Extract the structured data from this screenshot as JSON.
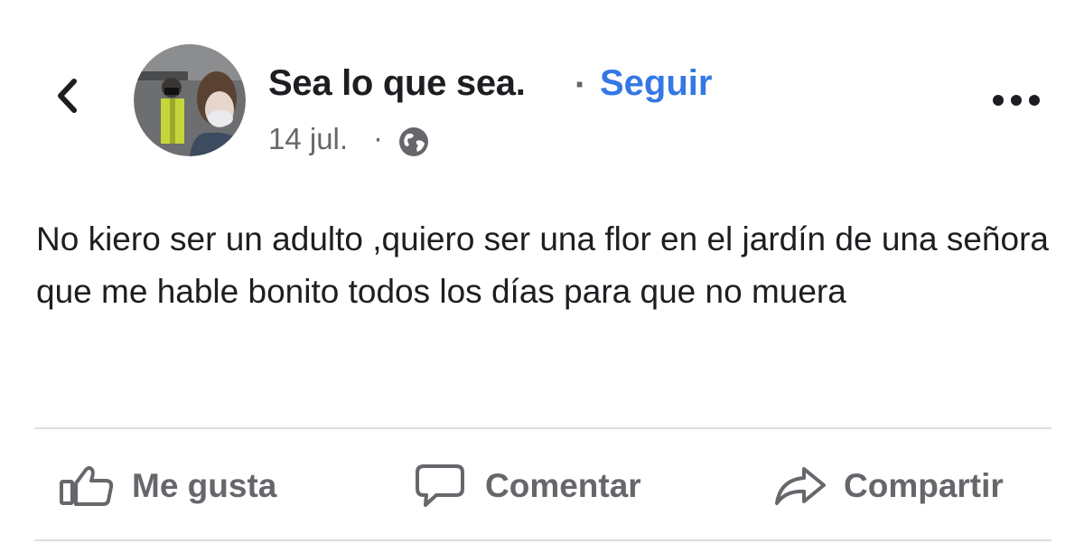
{
  "header": {
    "back_icon": "chevron-left-icon",
    "author_name": "Sea lo que sea.",
    "separator": "·",
    "follow_label": "Seguir",
    "date": "14 jul.",
    "date_separator": "·",
    "privacy_icon": "globe-icon",
    "more_icon": "more-horizontal-icon"
  },
  "post": {
    "text": "No kiero ser un adulto ,quiero ser una flor en el jardín de una señora que me hable bonito todos los días para que no muera"
  },
  "actions": [
    {
      "label": "Me gusta",
      "icon": "thumbs-up-icon"
    },
    {
      "label": "Comentar",
      "icon": "comment-icon"
    },
    {
      "label": "Compartir",
      "icon": "share-icon"
    }
  ],
  "colors": {
    "text": "#1c1e21",
    "secondary": "#65676b",
    "link": "#3578e5",
    "divider": "#dadde1"
  }
}
